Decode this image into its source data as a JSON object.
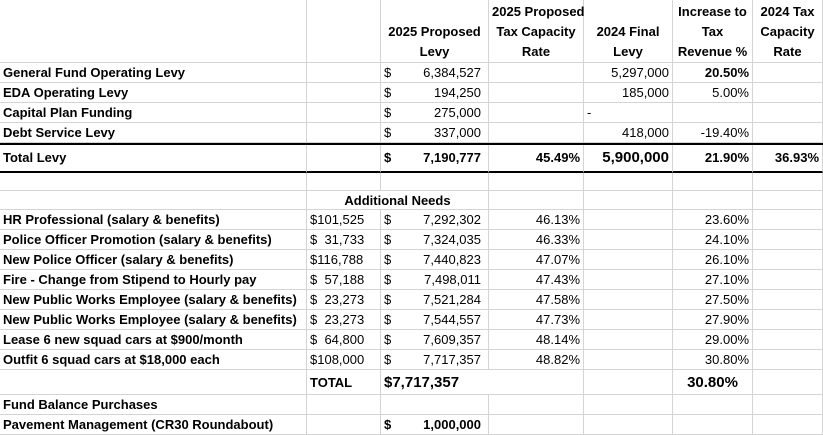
{
  "header": {
    "proposed_levy": [
      "2025 Proposed",
      "Levy"
    ],
    "proposed_rate": [
      "2025 Proposed",
      "Tax Capacity",
      "Rate"
    ],
    "final_levy": [
      "2024 Final",
      "Levy"
    ],
    "increase": [
      "Increase to",
      "Tax",
      "Revenue %"
    ],
    "rate_2024": [
      "2024 Tax",
      "Capacity",
      "Rate"
    ]
  },
  "levy_rows": [
    {
      "label": "General Fund Operating Levy",
      "dollar": "$",
      "proposed": "6,384,527",
      "final": "5,297,000",
      "increase": "20.50%",
      "increase_bold": true
    },
    {
      "label": "EDA Operating Levy",
      "dollar": "$",
      "proposed": "194,250",
      "final": "185,000",
      "increase": "5.00%"
    },
    {
      "label": "Capital Plan Funding",
      "dollar": "$",
      "proposed": "275,000",
      "final": "-",
      "increase": ""
    },
    {
      "label": "Debt Service Levy",
      "dollar": "$",
      "proposed": "337,000",
      "final": "418,000",
      "increase": "-19.40%"
    }
  ],
  "total_levy": {
    "label": "Total Levy",
    "dollar": "$",
    "proposed": "7,190,777",
    "rate": "45.49%",
    "final": "5,900,000",
    "increase": "21.90%",
    "rate_2024": "36.93%"
  },
  "additional_needs_title": "Additional Needs",
  "needs_rows": [
    {
      "label": "HR Professional (salary & benefits)",
      "cost": "$101,525",
      "dollar": "$",
      "levy": "7,292,302",
      "rate": "46.13%",
      "increase": "23.60%"
    },
    {
      "label": "Police Officer Promotion (salary & benefits)",
      "cost": "$  31,733",
      "dollar": "$",
      "levy": "7,324,035",
      "rate": "46.33%",
      "increase": "24.10%"
    },
    {
      "label": "New Police Officer (salary & benefits)",
      "cost": "$116,788",
      "dollar": "$",
      "levy": "7,440,823",
      "rate": "47.07%",
      "increase": "26.10%"
    },
    {
      "label": "Fire - Change from Stipend to Hourly pay",
      "cost": "$  57,188",
      "dollar": "$",
      "levy": "7,498,011",
      "rate": "47.43%",
      "increase": "27.10%"
    },
    {
      "label": "New Public Works Employee (salary & benefits)",
      "cost": "$  23,273",
      "dollar": "$",
      "levy": "7,521,284",
      "rate": "47.58%",
      "increase": "27.50%"
    },
    {
      "label": "New Public Works Employee (salary & benefits)",
      "cost": "$  23,273",
      "dollar": "$",
      "levy": "7,544,557",
      "rate": "47.73%",
      "increase": "27.90%"
    },
    {
      "label": "Lease 6 new squad cars at $900/month",
      "cost": "$  64,800",
      "dollar": "$",
      "levy": "7,609,357",
      "rate": "48.14%",
      "increase": "29.00%"
    },
    {
      "label": "Outfit 6 squad cars at $18,000 each",
      "cost": "$108,000",
      "dollar": "$",
      "levy": "7,717,357",
      "rate": "48.82%",
      "increase": "30.80%"
    }
  ],
  "needs_total": {
    "label": "TOTAL",
    "value": "$7,717,357",
    "increase": "30.80%"
  },
  "fund_balance": {
    "title": "Fund Balance Purchases",
    "item": "Pavement Management (CR30 Roundabout)",
    "dollar": "$",
    "value": "1,000,000"
  }
}
